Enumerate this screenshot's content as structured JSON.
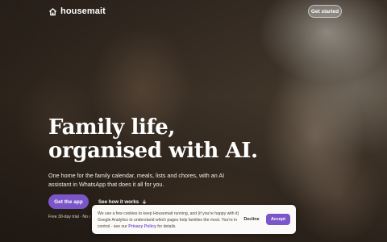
{
  "header": {
    "brand": "housemait",
    "cta_label": "Get started"
  },
  "hero": {
    "headline_line1": "Family life,",
    "headline_line2": "organised with AI.",
    "subline": "One home for the family calendar, meals, lists and chores, with an AI assistant in WhatsApp that does it all for you.",
    "primary_button": "Get the app",
    "secondary_button": "See how it works",
    "fineprint": "Free 30-day trial · No c"
  },
  "cookie_banner": {
    "text": "We use a few cookies to keep Housemait running, and (if you're happy with it) Google Analytics to understand which pages help families the most. You're in control - see our",
    "link_text": "Privacy Policy",
    "text_end": "for details.",
    "decline_label": "Decline",
    "accept_label": "Accept"
  },
  "colors": {
    "accent": "#7b56c8",
    "banner_bg": "#fbfaf8"
  },
  "icons": {
    "logo": "house-icon",
    "secondary_button": "arrow-down-icon"
  }
}
